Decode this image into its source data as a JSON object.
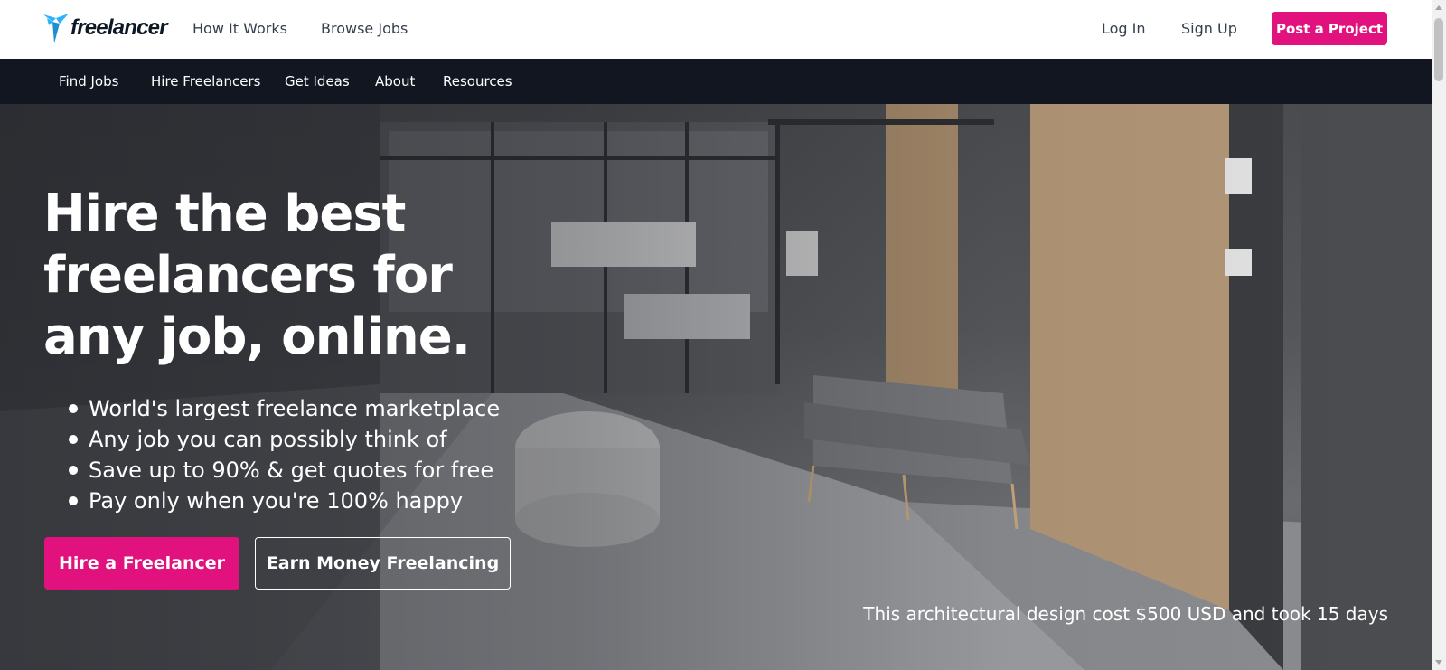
{
  "header": {
    "logo_text": "freelancer",
    "nav": [
      {
        "label": "How It Works"
      },
      {
        "label": "Browse Jobs"
      }
    ],
    "login_label": "Log In",
    "signup_label": "Sign Up",
    "post_project_label": "Post a Project"
  },
  "subnav": {
    "items": [
      {
        "label": "Find Jobs"
      },
      {
        "label": "Hire Freelancers"
      },
      {
        "label": "Get Ideas"
      },
      {
        "label": "About"
      },
      {
        "label": "Resources"
      }
    ]
  },
  "hero": {
    "title": "Hire the best freelancers for any job, online.",
    "bullets": [
      "World's largest freelance marketplace",
      "Any job you can possibly think of",
      "Save up to 90% & get quotes for free",
      "Pay only when you're 100% happy"
    ],
    "hire_button": "Hire a Freelancer",
    "earn_button": "Earn Money Freelancing",
    "caption": "This architectural design cost $500 USD and took 15 days"
  },
  "colors": {
    "brand_pink": "#e1127d",
    "brand_blue": "#29b2fe",
    "subnav_bg": "#121620"
  },
  "icons": {
    "logo": "freelancer-bird-icon",
    "bullet": "bullet-dot-icon"
  }
}
